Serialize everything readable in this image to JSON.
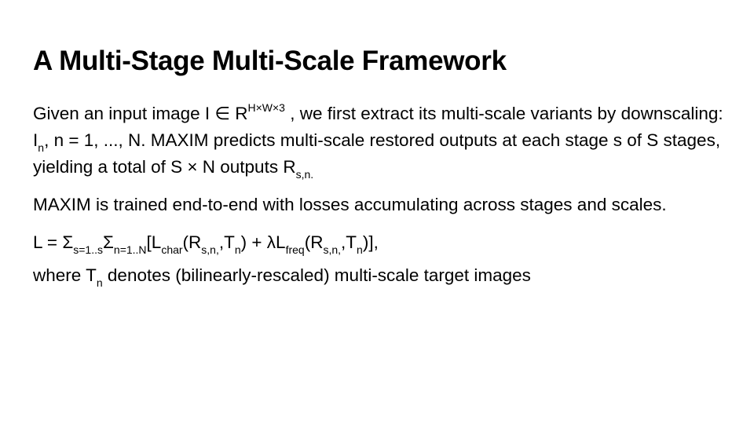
{
  "slide": {
    "title": "A Multi-Stage Multi-Scale Framework",
    "para1": {
      "t1": "Given an input image I ∈ R",
      "sup1": "H×W×3",
      "t2": " , we first extract its multi-scale variants by downscaling: I",
      "sub1": "n",
      "t3": ", n = 1, ..., N. MAXIM predicts multi-scale restored outputs at each stage s of S stages, yielding a total of S × N outputs R",
      "sub2": "s,n."
    },
    "para2": "MAXIM is trained end-to-end with losses accumulating across stages and scales.",
    "formula": {
      "f1": "L = Σ",
      "s1": "s=1..s",
      "f2": "Σ",
      "s2": "n=1..N",
      "f3": "[L",
      "s3": "char",
      "f4": "(R",
      "s4": "s,n,",
      "f5": ",T",
      "s5": "n",
      "f6": ") + λL",
      "s6": "freq",
      "f7": "(R",
      "s7": "s,n,",
      "f8": ",T",
      "s8": "n",
      "f9": ")],"
    },
    "note": {
      "t1": "where T",
      "sub1": "n",
      "t2": " denotes (bilinearly-rescaled) multi-scale target images"
    }
  }
}
